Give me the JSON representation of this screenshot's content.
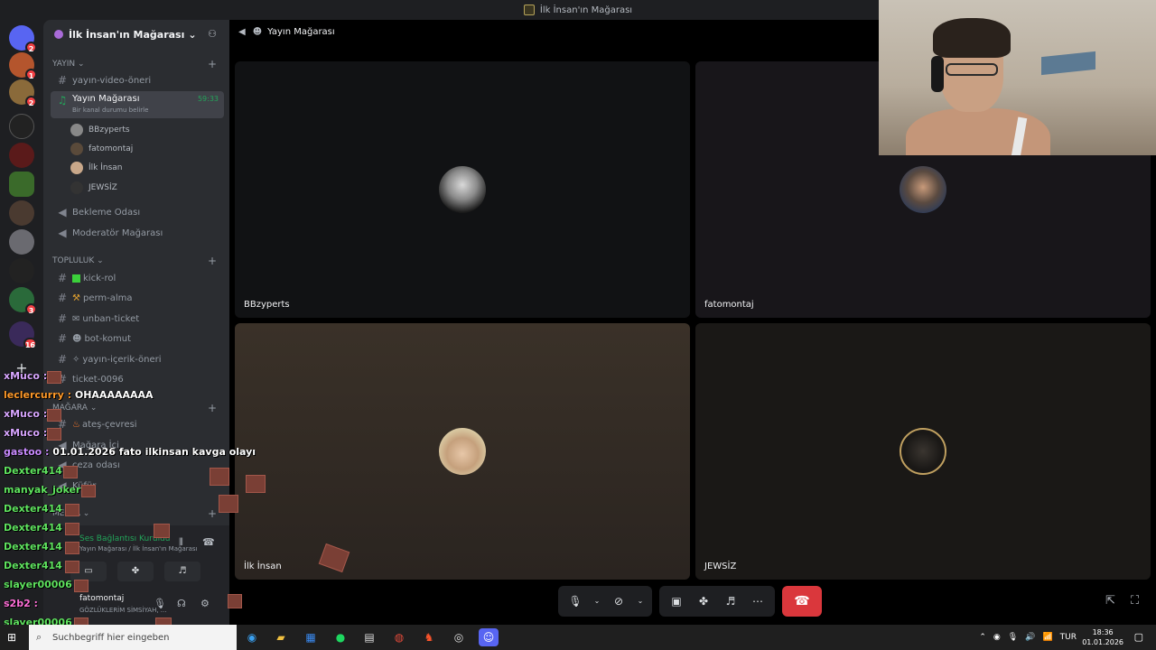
{
  "window": {
    "title": "İlk İnsan'ın Mağarası"
  },
  "rail": {
    "badges": [
      "2",
      "1",
      "2",
      "3",
      "16"
    ]
  },
  "sidebar": {
    "server_name": "İlk İnsan'ın Mağarası",
    "categories": {
      "yayin": "YAYIN",
      "topluluk": "TOPLULUK",
      "magara": "MAĞARA",
      "medya": "Medya"
    },
    "channels": {
      "yayin_video": "yayın-video-öneri",
      "yayin_magarasi": "Yayın Mağarası",
      "yayin_magarasi_time": "59:33",
      "yayin_magarasi_status": "Bir kanal durumu belirle",
      "bekleme": "Bekleme Odası",
      "moderator": "Moderatör Mağarası",
      "kick_rol": "kick-rol",
      "perm_alma": "perm-alma",
      "unban_ticket": "unban-ticket",
      "bot_komut": "bot-komut",
      "yayin_icerik": "yayın-içerik-öneri",
      "ticket": "ticket-0096",
      "ates": "ateş-çevresi",
      "magara_ici": "Mağara İçi",
      "ceza": "ceza odası",
      "kufur": "Küfür"
    },
    "voice_users": [
      "BBzyperts",
      "fatomontaj",
      "İlk İnsan",
      "JEWSİZ"
    ],
    "voice_panel": {
      "status": "Ses Bağlantısı Kuruldu",
      "path": "Yayın Mağarası / İlk İnsan'ın Mağarası"
    },
    "user": {
      "name": "fatomontaj",
      "status": "GÖZLÜKLERİM SİMSİYAH, ..."
    }
  },
  "stage": {
    "channel": "Yayın Mağarası",
    "tiles": [
      {
        "name": "BBzyperts"
      },
      {
        "name": "fatomontaj"
      },
      {
        "name": "İlk İnsan"
      },
      {
        "name": "JEWSİZ"
      }
    ]
  },
  "chat": [
    {
      "user": "xMuco :",
      "color": "#d8a6ff",
      "text": ""
    },
    {
      "user": "leclercurry :",
      "color": "#ff9a2a",
      "text": "OHAAAAAAAA"
    },
    {
      "user": "xMuco :",
      "color": "#d8a6ff",
      "text": ""
    },
    {
      "user": "xMuco :",
      "color": "#d8a6ff",
      "text": ""
    },
    {
      "user": "gastoo :",
      "color": "#c98bff",
      "text": "01.01.2026 fato ilkinsan kavga olayı"
    },
    {
      "user": "Dexter414 :",
      "color": "#5fe35f",
      "text": ""
    },
    {
      "user": "manyak_joker :",
      "color": "#5fe35f",
      "text": ""
    },
    {
      "user": "Dexter414 :",
      "color": "#5fe35f",
      "text": ""
    },
    {
      "user": "Dexter414 :",
      "color": "#5fe35f",
      "text": ""
    },
    {
      "user": "Dexter414 :",
      "color": "#5fe35f",
      "text": ""
    },
    {
      "user": "Dexter414 :",
      "color": "#5fe35f",
      "text": ""
    },
    {
      "user": "slayer00006 :",
      "color": "#5fe35f",
      "text": ""
    },
    {
      "user": "s2b2 :",
      "color": "#ff6fd8",
      "text": ""
    },
    {
      "user": "slayer00006 :",
      "color": "#5fe35f",
      "text": ""
    }
  ],
  "taskbar": {
    "search_placeholder": "Suchbegriff hier eingeben",
    "lang": "TUR",
    "time": "18:36",
    "date": "01.01.2026"
  },
  "colors": {
    "accent_green": "#23a55a",
    "end_call": "#da373c",
    "badge": "#f23f43"
  },
  "icons": {
    "start": "windows-start-icon",
    "search": "search-icon",
    "mic": "microphone-icon",
    "camera_off": "camera-off-icon",
    "screen_share": "screen-share-icon",
    "activities": "activities-icon",
    "soundboard": "soundboard-icon",
    "more": "more-icon",
    "end_call": "hang-up-icon"
  }
}
